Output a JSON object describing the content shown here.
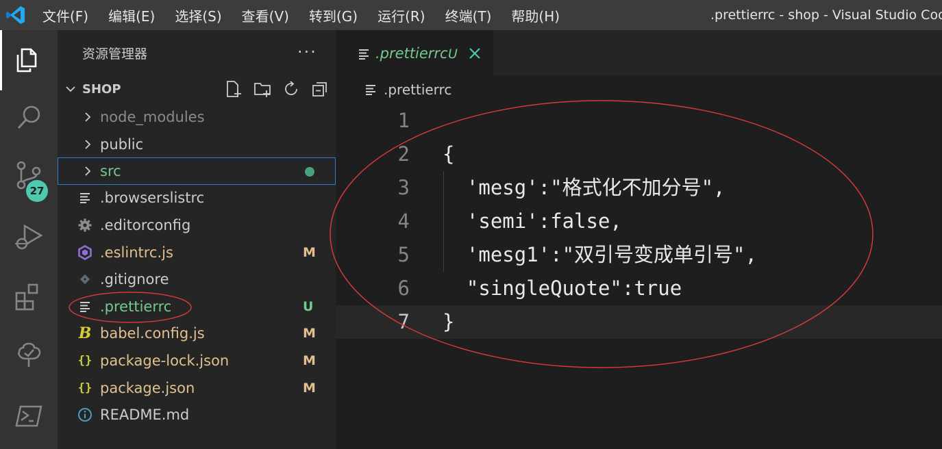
{
  "menubar": {
    "items": [
      "文件(F)",
      "编辑(E)",
      "选择(S)",
      "查看(V)",
      "转到(G)",
      "运行(R)",
      "终端(T)",
      "帮助(H)"
    ],
    "window_title": ".prettierrc - shop - Visual Studio Code"
  },
  "activity_bar": {
    "icons": [
      "explorer-icon",
      "search-icon",
      "source-control-icon",
      "run-debug-icon",
      "extensions-icon",
      "remote-explorer-icon",
      "powershell-icon"
    ],
    "scm_badge": "27"
  },
  "sidebar": {
    "title": "资源管理器",
    "more": "···",
    "section": "SHOP",
    "files": [
      {
        "name": "node_modules",
        "type": "folder",
        "status": "",
        "color": "#8b8b8b"
      },
      {
        "name": "public",
        "type": "folder",
        "status": "",
        "color": "#cccccc"
      },
      {
        "name": "src",
        "type": "folder",
        "status": "dot",
        "color": "#73c991"
      },
      {
        "name": ".browserslistrc",
        "type": "text",
        "status": "",
        "color": "#cccccc"
      },
      {
        "name": ".editorconfig",
        "type": "gear",
        "status": "",
        "color": "#cccccc"
      },
      {
        "name": ".eslintrc.js",
        "type": "eslint",
        "status": "M",
        "color": "#e2c08d"
      },
      {
        "name": ".gitignore",
        "type": "git",
        "status": "",
        "color": "#cccccc"
      },
      {
        "name": ".prettierrc",
        "type": "text",
        "status": "U",
        "color": "#73c991"
      },
      {
        "name": "babel.config.js",
        "type": "babel",
        "status": "M",
        "color": "#e2c08d"
      },
      {
        "name": "package-lock.json",
        "type": "json",
        "status": "M",
        "color": "#e2c08d"
      },
      {
        "name": "package.json",
        "type": "json",
        "status": "M",
        "color": "#e2c08d"
      },
      {
        "name": "README.md",
        "type": "info",
        "status": "",
        "color": "#cccccc"
      }
    ]
  },
  "editor": {
    "tab": {
      "label": ".prettierrc",
      "status": "U"
    },
    "breadcrumb": ".prettierrc",
    "lines": [
      {
        "n": "1",
        "text": ""
      },
      {
        "n": "2",
        "text": "{"
      },
      {
        "n": "3",
        "text": "  'mesg':\"格式化不加分号\","
      },
      {
        "n": "4",
        "text": "  'semi':false,"
      },
      {
        "n": "5",
        "text": "  'mesg1':\"双引号变成单引号\","
      },
      {
        "n": "6",
        "text": "  \"singleQuote\":true"
      },
      {
        "n": "7",
        "text": "}"
      }
    ],
    "current_line": "7"
  },
  "colors": {
    "accent_green": "#73c991",
    "modified": "#e2c08d",
    "annotation_red": "#d43a3a"
  }
}
